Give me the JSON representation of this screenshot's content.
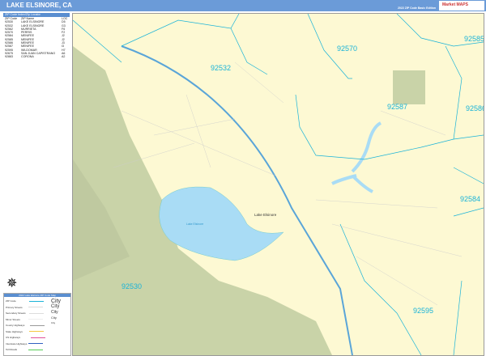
{
  "header": {
    "title": "LAKE ELSINORE, CA",
    "edition": "2022 ZIP Code Basic Edition",
    "logo": "Market MAPS"
  },
  "index": {
    "title": "ZIP Code Index/Zip Locator",
    "columns": [
      "ZIP Code",
      "ZIP Name",
      "LOC"
    ],
    "rows": [
      [
        "92530",
        "LAKE ELSINORE",
        "D5"
      ],
      [
        "92532",
        "LAKE ELSINORE",
        "G3"
      ],
      [
        "92562",
        "MURRIETA",
        "F6"
      ],
      [
        "92570",
        "PERRIS",
        "F2"
      ],
      [
        "92584",
        "MENIFEE",
        "J2"
      ],
      [
        "92585",
        "MENIFEE",
        "J2"
      ],
      [
        "92586",
        "MENIFEE",
        "J3"
      ],
      [
        "92587",
        "MENIFEE",
        "I3"
      ],
      [
        "92595",
        "WILDOMAR",
        "H7"
      ],
      [
        "92675",
        "SAN JUAN CAPISTRANO",
        "A6"
      ],
      [
        "92883",
        "CORONA",
        "A2"
      ]
    ]
  },
  "map": {
    "zips": [
      {
        "z": "92532"
      },
      {
        "z": "92570"
      },
      {
        "z": "92585"
      },
      {
        "z": "92587"
      },
      {
        "z": "92584"
      },
      {
        "z": "92530"
      },
      {
        "z": "92595"
      },
      {
        "z": "92586"
      }
    ],
    "city_label": "Lake Elsinore",
    "lake_label": "Lake Elsinore"
  },
  "legend": {
    "title": "2022 Lake Elsinore ZIP Code Map",
    "items": [
      "ZIP Code",
      "Primary Streets",
      "Secondary Streets",
      "Minor Streets",
      "County Highways",
      "State Highways",
      "US Highways",
      "Interstate Highways",
      "Toll Roads"
    ],
    "city_sizes": [
      "City",
      "City",
      "City",
      "City",
      "City"
    ]
  },
  "colors": {
    "header": "#6b9bd8",
    "land": "#fdf9d3",
    "park": "#c9d3a8",
    "water": "#a9dcf5",
    "zip": "#1ab3d8"
  }
}
